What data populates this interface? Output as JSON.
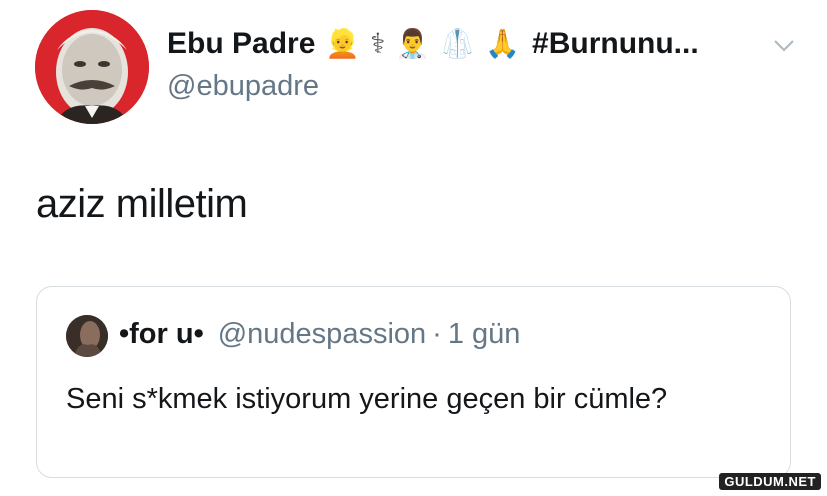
{
  "author": {
    "name": "Ebu Padre",
    "emojis": [
      "👱",
      "⚕",
      "👨‍⚕️",
      "🥼",
      "🙏"
    ],
    "hashtag": "#Burnunu...",
    "handle": "@ebupadre"
  },
  "tweet": {
    "text": "aziz milletim"
  },
  "quoted_tweet": {
    "name": "•for u•",
    "handle": "@nudespassion",
    "separator": "·",
    "time": "1 gün",
    "text": "Seni s*kmek istiyorum yerine geçen bir cümle?"
  },
  "watermark": "GULDUM.NET",
  "colors": {
    "avatar_bg": "#d9262c",
    "secondary_text": "#657786",
    "border": "#d8dde1"
  }
}
